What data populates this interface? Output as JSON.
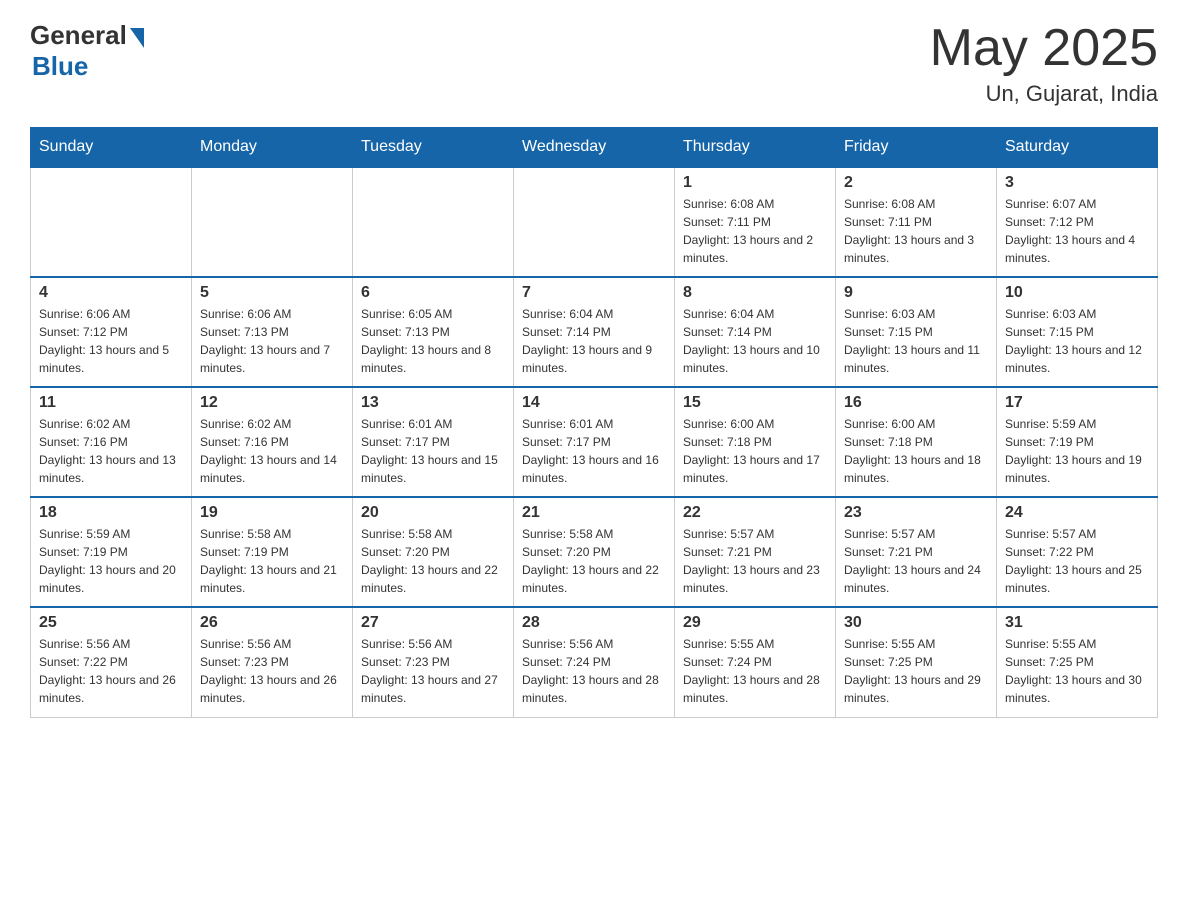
{
  "header": {
    "logo_general": "General",
    "logo_blue": "Blue",
    "month_year": "May 2025",
    "location": "Un, Gujarat, India"
  },
  "weekdays": [
    "Sunday",
    "Monday",
    "Tuesday",
    "Wednesday",
    "Thursday",
    "Friday",
    "Saturday"
  ],
  "weeks": [
    [
      {
        "day": "",
        "sunrise": "",
        "sunset": "",
        "daylight": ""
      },
      {
        "day": "",
        "sunrise": "",
        "sunset": "",
        "daylight": ""
      },
      {
        "day": "",
        "sunrise": "",
        "sunset": "",
        "daylight": ""
      },
      {
        "day": "",
        "sunrise": "",
        "sunset": "",
        "daylight": ""
      },
      {
        "day": "1",
        "sunrise": "Sunrise: 6:08 AM",
        "sunset": "Sunset: 7:11 PM",
        "daylight": "Daylight: 13 hours and 2 minutes."
      },
      {
        "day": "2",
        "sunrise": "Sunrise: 6:08 AM",
        "sunset": "Sunset: 7:11 PM",
        "daylight": "Daylight: 13 hours and 3 minutes."
      },
      {
        "day": "3",
        "sunrise": "Sunrise: 6:07 AM",
        "sunset": "Sunset: 7:12 PM",
        "daylight": "Daylight: 13 hours and 4 minutes."
      }
    ],
    [
      {
        "day": "4",
        "sunrise": "Sunrise: 6:06 AM",
        "sunset": "Sunset: 7:12 PM",
        "daylight": "Daylight: 13 hours and 5 minutes."
      },
      {
        "day": "5",
        "sunrise": "Sunrise: 6:06 AM",
        "sunset": "Sunset: 7:13 PM",
        "daylight": "Daylight: 13 hours and 7 minutes."
      },
      {
        "day": "6",
        "sunrise": "Sunrise: 6:05 AM",
        "sunset": "Sunset: 7:13 PM",
        "daylight": "Daylight: 13 hours and 8 minutes."
      },
      {
        "day": "7",
        "sunrise": "Sunrise: 6:04 AM",
        "sunset": "Sunset: 7:14 PM",
        "daylight": "Daylight: 13 hours and 9 minutes."
      },
      {
        "day": "8",
        "sunrise": "Sunrise: 6:04 AM",
        "sunset": "Sunset: 7:14 PM",
        "daylight": "Daylight: 13 hours and 10 minutes."
      },
      {
        "day": "9",
        "sunrise": "Sunrise: 6:03 AM",
        "sunset": "Sunset: 7:15 PM",
        "daylight": "Daylight: 13 hours and 11 minutes."
      },
      {
        "day": "10",
        "sunrise": "Sunrise: 6:03 AM",
        "sunset": "Sunset: 7:15 PM",
        "daylight": "Daylight: 13 hours and 12 minutes."
      }
    ],
    [
      {
        "day": "11",
        "sunrise": "Sunrise: 6:02 AM",
        "sunset": "Sunset: 7:16 PM",
        "daylight": "Daylight: 13 hours and 13 minutes."
      },
      {
        "day": "12",
        "sunrise": "Sunrise: 6:02 AM",
        "sunset": "Sunset: 7:16 PM",
        "daylight": "Daylight: 13 hours and 14 minutes."
      },
      {
        "day": "13",
        "sunrise": "Sunrise: 6:01 AM",
        "sunset": "Sunset: 7:17 PM",
        "daylight": "Daylight: 13 hours and 15 minutes."
      },
      {
        "day": "14",
        "sunrise": "Sunrise: 6:01 AM",
        "sunset": "Sunset: 7:17 PM",
        "daylight": "Daylight: 13 hours and 16 minutes."
      },
      {
        "day": "15",
        "sunrise": "Sunrise: 6:00 AM",
        "sunset": "Sunset: 7:18 PM",
        "daylight": "Daylight: 13 hours and 17 minutes."
      },
      {
        "day": "16",
        "sunrise": "Sunrise: 6:00 AM",
        "sunset": "Sunset: 7:18 PM",
        "daylight": "Daylight: 13 hours and 18 minutes."
      },
      {
        "day": "17",
        "sunrise": "Sunrise: 5:59 AM",
        "sunset": "Sunset: 7:19 PM",
        "daylight": "Daylight: 13 hours and 19 minutes."
      }
    ],
    [
      {
        "day": "18",
        "sunrise": "Sunrise: 5:59 AM",
        "sunset": "Sunset: 7:19 PM",
        "daylight": "Daylight: 13 hours and 20 minutes."
      },
      {
        "day": "19",
        "sunrise": "Sunrise: 5:58 AM",
        "sunset": "Sunset: 7:19 PM",
        "daylight": "Daylight: 13 hours and 21 minutes."
      },
      {
        "day": "20",
        "sunrise": "Sunrise: 5:58 AM",
        "sunset": "Sunset: 7:20 PM",
        "daylight": "Daylight: 13 hours and 22 minutes."
      },
      {
        "day": "21",
        "sunrise": "Sunrise: 5:58 AM",
        "sunset": "Sunset: 7:20 PM",
        "daylight": "Daylight: 13 hours and 22 minutes."
      },
      {
        "day": "22",
        "sunrise": "Sunrise: 5:57 AM",
        "sunset": "Sunset: 7:21 PM",
        "daylight": "Daylight: 13 hours and 23 minutes."
      },
      {
        "day": "23",
        "sunrise": "Sunrise: 5:57 AM",
        "sunset": "Sunset: 7:21 PM",
        "daylight": "Daylight: 13 hours and 24 minutes."
      },
      {
        "day": "24",
        "sunrise": "Sunrise: 5:57 AM",
        "sunset": "Sunset: 7:22 PM",
        "daylight": "Daylight: 13 hours and 25 minutes."
      }
    ],
    [
      {
        "day": "25",
        "sunrise": "Sunrise: 5:56 AM",
        "sunset": "Sunset: 7:22 PM",
        "daylight": "Daylight: 13 hours and 26 minutes."
      },
      {
        "day": "26",
        "sunrise": "Sunrise: 5:56 AM",
        "sunset": "Sunset: 7:23 PM",
        "daylight": "Daylight: 13 hours and 26 minutes."
      },
      {
        "day": "27",
        "sunrise": "Sunrise: 5:56 AM",
        "sunset": "Sunset: 7:23 PM",
        "daylight": "Daylight: 13 hours and 27 minutes."
      },
      {
        "day": "28",
        "sunrise": "Sunrise: 5:56 AM",
        "sunset": "Sunset: 7:24 PM",
        "daylight": "Daylight: 13 hours and 28 minutes."
      },
      {
        "day": "29",
        "sunrise": "Sunrise: 5:55 AM",
        "sunset": "Sunset: 7:24 PM",
        "daylight": "Daylight: 13 hours and 28 minutes."
      },
      {
        "day": "30",
        "sunrise": "Sunrise: 5:55 AM",
        "sunset": "Sunset: 7:25 PM",
        "daylight": "Daylight: 13 hours and 29 minutes."
      },
      {
        "day": "31",
        "sunrise": "Sunrise: 5:55 AM",
        "sunset": "Sunset: 7:25 PM",
        "daylight": "Daylight: 13 hours and 30 minutes."
      }
    ]
  ]
}
